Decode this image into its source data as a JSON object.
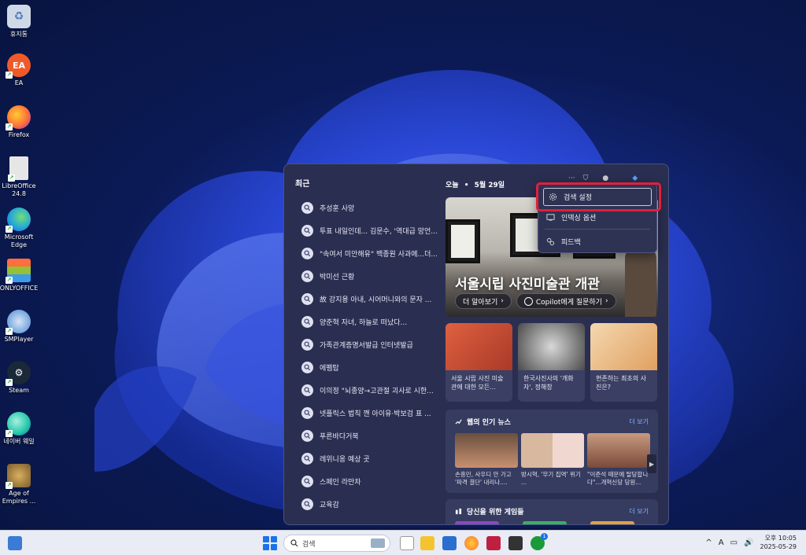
{
  "desktop": {
    "icons": [
      {
        "label": "휴지통",
        "icon": "recycle-bin-icon",
        "color": "#cfd8e6"
      },
      {
        "label": "EA",
        "icon": "ea-icon",
        "color": "#f05a28"
      },
      {
        "label": "Firefox",
        "icon": "firefox-icon",
        "color": "#ff7139"
      },
      {
        "label": "LibreOffice 24.8",
        "icon": "libreoffice-icon",
        "color": "#e6e6e6"
      },
      {
        "label": "Microsoft Edge",
        "icon": "edge-icon",
        "color": "#1fa0e0"
      },
      {
        "label": "ONLYOFFICE",
        "icon": "onlyoffice-icon",
        "color": "#ff6f3d"
      },
      {
        "label": "SMPlayer",
        "icon": "smplayer-icon",
        "color": "#4a8ad6"
      },
      {
        "label": "Steam",
        "icon": "steam-icon",
        "color": "#1b2838"
      },
      {
        "label": "네이버 웨일",
        "icon": "whale-icon",
        "color": "#22c7a9"
      },
      {
        "label": "Age of Empires ...",
        "icon": "age-of-empires-icon",
        "color": "#7a5a2a"
      }
    ]
  },
  "search_panel": {
    "recent_title": "최근",
    "recent_items": [
      "추성훈 사망",
      "투표 내일인데... 김문수, '역대급 망언...",
      "\"속여서 미안해유\" 백종원 사과에...더...",
      "박미선 근황",
      "故 강지용 아내, 시어머니와의 문자 ...",
      "양준혁 자녀, 하늘로 떠났다...",
      "가족관계증명서발급 인터넷발급",
      "에펨탑",
      "이의정 \"뇌종양→고관절 괴사로 시한...",
      "넷플릭스 법칙 깬 아이유·박보검 표 ...",
      "푸른바다거북",
      "레위니옹 예상 곳",
      "스페인 라만차",
      "교육감"
    ],
    "today_label": "오늘",
    "date": "5월 29일",
    "hero": {
      "title": "서울시립 사진미술관 개관",
      "btn_more": "더 알아보기",
      "btn_copilot": "Copilot에게 질문하기"
    },
    "cards": [
      {
        "text": "서울 시립 사진 미술관에 대한 모든...",
        "color": "#c8523a"
      },
      {
        "text": "한국사진사의 '개화자', 정해창",
        "color": "#8a8a8a"
      },
      {
        "text": "현존하는 최초의 사진은?",
        "color": "#e8c9a0"
      }
    ],
    "news": {
      "title": "웹의 인기 뉴스",
      "more": "더 보기",
      "items": [
        {
          "text": "손흥민, 사우디 안 가고 '파격 결단' 내리나....",
          "color": "#b07a5a"
        },
        {
          "text": "방시혁, '무기 집역' 위기 ...",
          "color": "#d9b8a0"
        },
        {
          "text": "",
          "color": "#e8c8c0"
        },
        {
          "text": "\"이준석 때문에 탈당합니다\"...개혁신당 당원...",
          "color": "#9a6a50"
        }
      ]
    },
    "games": {
      "title": "당신을 위한 게임들",
      "more": "더 보기"
    }
  },
  "context_menu": {
    "items": [
      {
        "label": "검색 설정",
        "icon": "gear-icon"
      },
      {
        "label": "인덱싱 옵션",
        "icon": "indexing-icon"
      },
      {
        "label": "피드백",
        "icon": "feedback-icon"
      }
    ],
    "highlight_color": "#e0203a"
  },
  "taskbar": {
    "search_placeholder": "검색",
    "tray_ime": "A",
    "time": "오후 10:05",
    "date": "2025-05-29",
    "notification_badge": "1"
  }
}
